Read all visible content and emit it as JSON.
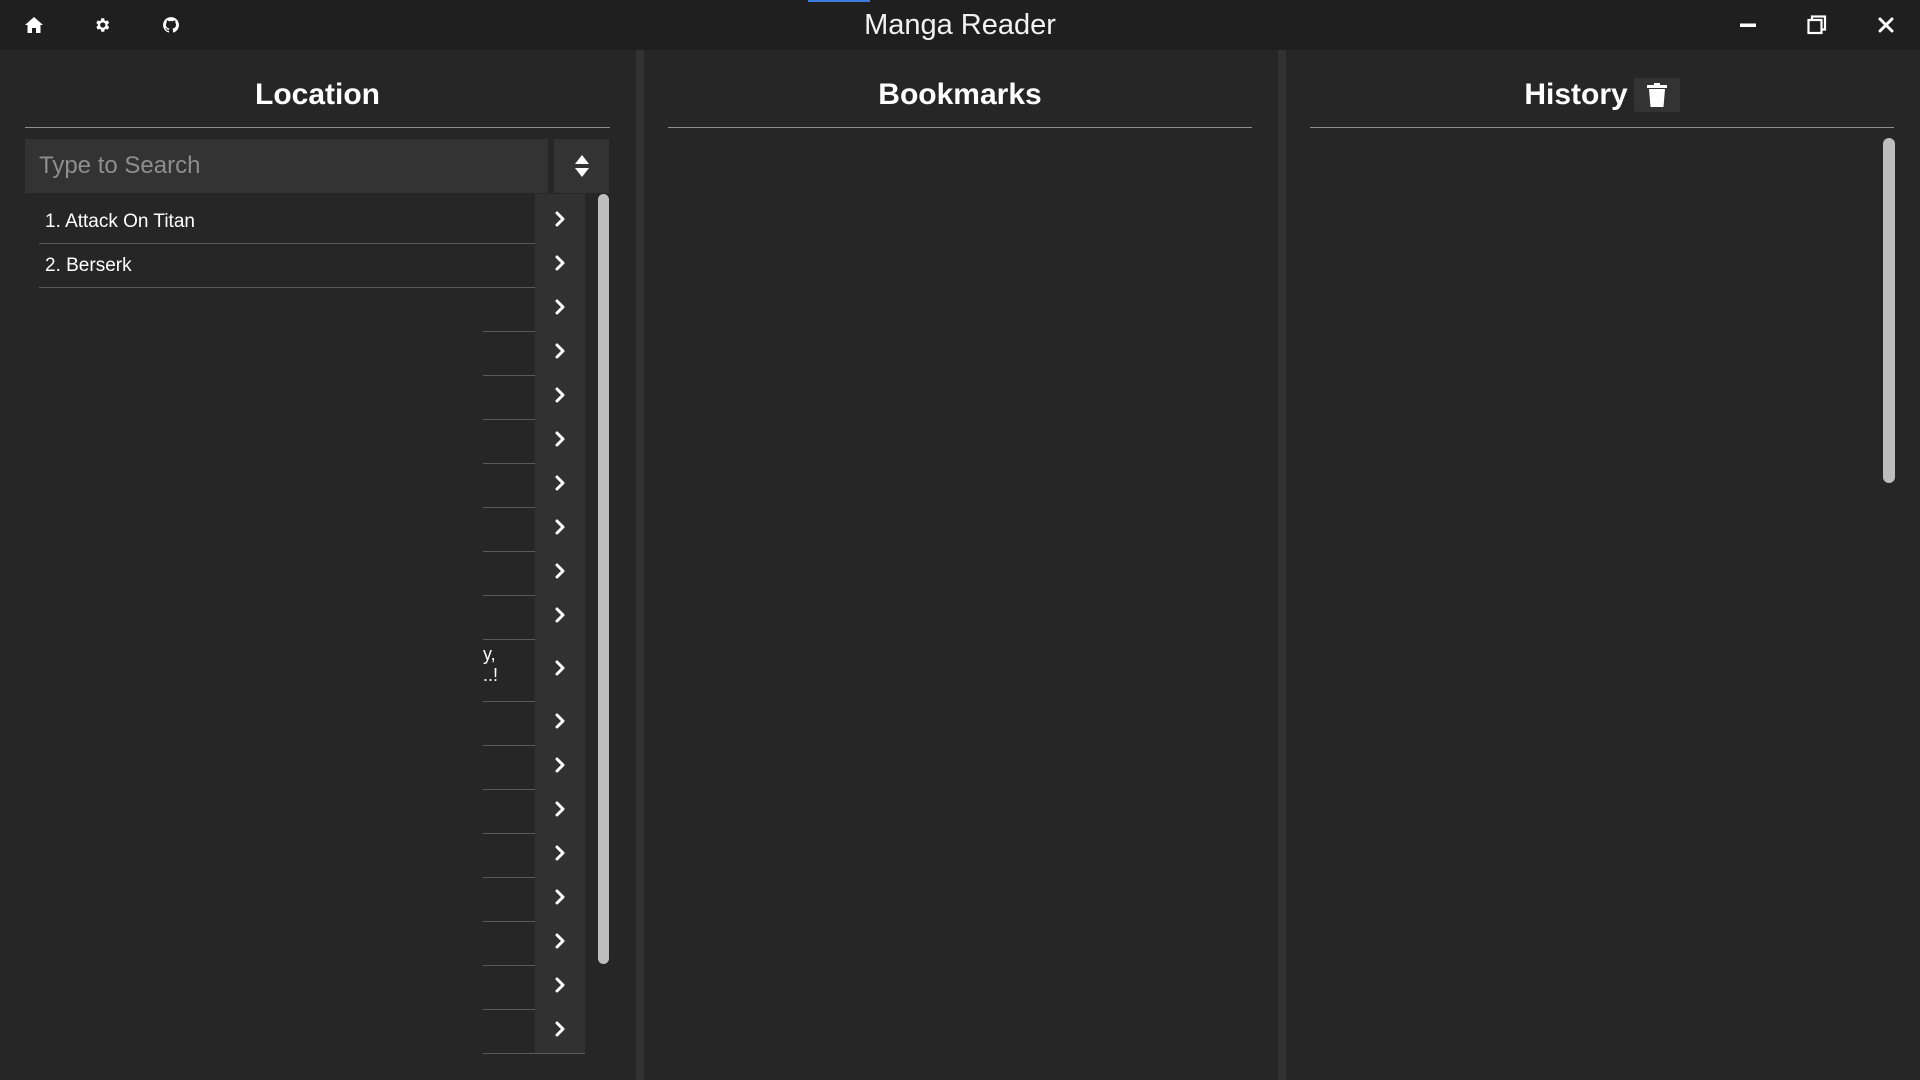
{
  "app": {
    "title": "Manga Reader"
  },
  "titlebar": {
    "left_buttons": [
      {
        "name": "home-icon"
      },
      {
        "name": "gear-icon"
      },
      {
        "name": "github-icon"
      }
    ],
    "right_buttons": [
      {
        "name": "minimize-icon"
      },
      {
        "name": "restore-icon"
      },
      {
        "name": "close-icon"
      }
    ],
    "accent_color": "#3d7be0"
  },
  "location": {
    "header": "Location",
    "search_placeholder": "Type to Search",
    "sort_icon": "sort-icon",
    "items": [
      {
        "label": "1. Attack On Titan"
      },
      {
        "label": "2. Berserk"
      },
      {
        "label": ""
      },
      {
        "label": ""
      },
      {
        "label": ""
      },
      {
        "label": ""
      },
      {
        "label": ""
      },
      {
        "label": ""
      },
      {
        "label": ""
      },
      {
        "label": ""
      },
      {
        "label": "y,\n..!"
      },
      {
        "label": ""
      },
      {
        "label": ""
      },
      {
        "label": ""
      },
      {
        "label": ""
      },
      {
        "label": ""
      },
      {
        "label": ""
      },
      {
        "label": ""
      },
      {
        "label": ""
      }
    ]
  },
  "bookmarks": {
    "header": "Bookmarks"
  },
  "history": {
    "header": "History",
    "clear_icon": "trash-icon"
  },
  "colors": {
    "background": "#262626",
    "titlebar": "#1f1f1f",
    "divider": "#323232",
    "input": "#333333"
  }
}
